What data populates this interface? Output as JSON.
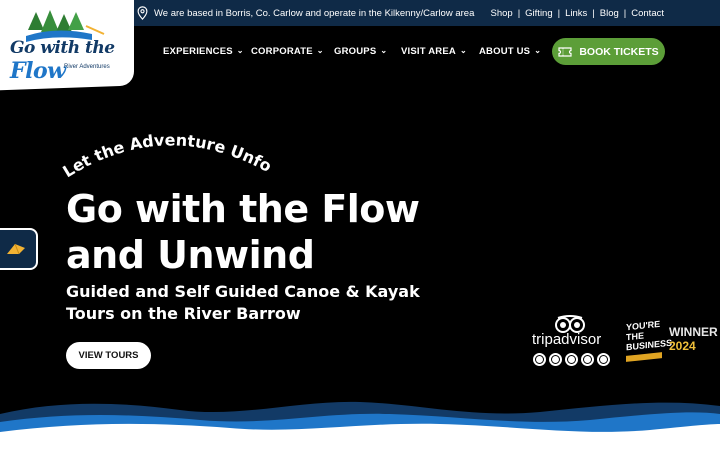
{
  "topbar": {
    "location_text": "We are based in Borris, Co. Carlow and operate in the Kilkenny/Carlow area",
    "links": [
      {
        "label": "Shop"
      },
      {
        "label": "Gifting"
      },
      {
        "label": "Links"
      },
      {
        "label": "Blog"
      },
      {
        "label": "Contact"
      }
    ]
  },
  "logo": {
    "line1": "Go with the",
    "line2": "Flow",
    "tagline": "River Adventures"
  },
  "nav": {
    "items": [
      {
        "label": "EXPERIENCES"
      },
      {
        "label": "CORPORATE"
      },
      {
        "label": "GROUPS"
      },
      {
        "label": "VISIT AREA"
      },
      {
        "label": "ABOUT US"
      }
    ],
    "book_button": "BOOK TICKETS"
  },
  "hero": {
    "arc_text": "Let the Adventure Unfold",
    "title_line1": "Go with the Flow",
    "title_line2": "and Unwind",
    "subtitle_line1": "Guided and Self Guided Canoe & Kayak",
    "subtitle_line2": "Tours on the River Barrow",
    "cta": "VIEW TOURS"
  },
  "badges": {
    "tripadvisor_name": "tripadvisor",
    "tripadvisor_rating_dots": 5,
    "award_lines": [
      "YOU'RE",
      "THE",
      "BUSINESS"
    ],
    "award_winner": "WINNER",
    "award_year": "2024"
  },
  "colors": {
    "topbar": "#0f2a47",
    "accent_green": "#5c9e38",
    "wave_dark": "#123a66",
    "wave_mid": "#1f76c8"
  },
  "icons": {
    "location": "map-pin-icon",
    "ticket": "ticket-icon",
    "side_tab": "tent-icon"
  }
}
